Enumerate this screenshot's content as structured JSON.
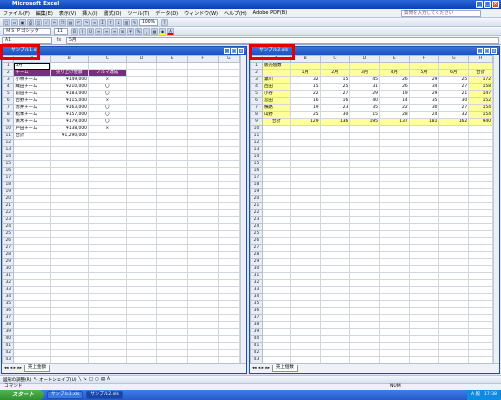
{
  "app": {
    "title": "Microsoft Excel"
  },
  "menu": [
    "ファイル(F)",
    "編集(E)",
    "表示(V)",
    "挿入(I)",
    "書式(O)",
    "ツール(T)",
    "データ(D)",
    "ウィンドウ(W)",
    "ヘルプ(H)",
    "Adobe PDF(B)"
  ],
  "help_placeholder": "質問を入力してください",
  "toolbar": {
    "zoom": "100%",
    "font": "ＭＳ Ｐゴシック",
    "size": "11"
  },
  "formula": {
    "cell": "A1",
    "fx": "fx",
    "value": "5月"
  },
  "left": {
    "title": "サンプル1.xls",
    "columns": [
      "A",
      "B",
      "C",
      "D",
      "E",
      "F",
      "G"
    ],
    "header": [
      "チーム",
      "売り上げ金額",
      "ノルマ達成"
    ],
    "a1": "5月",
    "rows": [
      [
        "小林チーム",
        "¥149,000",
        "×"
      ],
      [
        "織田チーム",
        "¥210,000",
        "〇"
      ],
      [
        "前田チーム",
        "¥183,000",
        "〇"
      ],
      [
        "古野チーム",
        "¥115,000",
        "×"
      ],
      [
        "赤井チーム",
        "¥163,000",
        "〇"
      ],
      [
        "松本チーム",
        "¥157,000",
        "〇"
      ],
      [
        "斎木チーム",
        "¥179,000",
        "〇"
      ],
      [
        "戸田チーム",
        "¥138,000",
        "×"
      ]
    ],
    "total": [
      "合計",
      "¥1,290,000"
    ],
    "tab": "売上金額"
  },
  "right": {
    "title": "サンプル2.xls",
    "columns": [
      "A",
      "B",
      "C",
      "D",
      "E",
      "F",
      "G",
      "H"
    ],
    "a1": "販売個数",
    "months": [
      "1月",
      "2月",
      "3月",
      "4月",
      "5月",
      "6月",
      "合計"
    ],
    "rows": [
      [
        "瀬川",
        "32",
        "15",
        "45",
        "26",
        "29",
        "25",
        "172"
      ],
      [
        "西田",
        "15",
        "25",
        "31",
        "26",
        "34",
        "27",
        "158"
      ],
      [
        "小谷",
        "22",
        "27",
        "29",
        "19",
        "29",
        "21",
        "147"
      ],
      [
        "宮田",
        "16",
        "16",
        "40",
        "14",
        "35",
        "30",
        "152"
      ],
      [
        "横路",
        "19",
        "23",
        "35",
        "22",
        "30",
        "27",
        "154"
      ],
      [
        "山野",
        "25",
        "30",
        "15",
        "28",
        "24",
        "32",
        "154"
      ]
    ],
    "total": [
      "合計",
      "129",
      "136",
      "195",
      "137",
      "181",
      "162",
      "940"
    ],
    "tab": "売上個数"
  },
  "drawbar": {
    "draw": "図形の調整(R)",
    "autoshape": "オートシェイプ(U)"
  },
  "status": {
    "left": "コマンド",
    "right": "NUM"
  },
  "taskbar": {
    "start": "スタート",
    "items": [
      "サンプル1.xls",
      "サンプル2.xls"
    ],
    "tray": [
      "A 般",
      "17:38"
    ]
  }
}
